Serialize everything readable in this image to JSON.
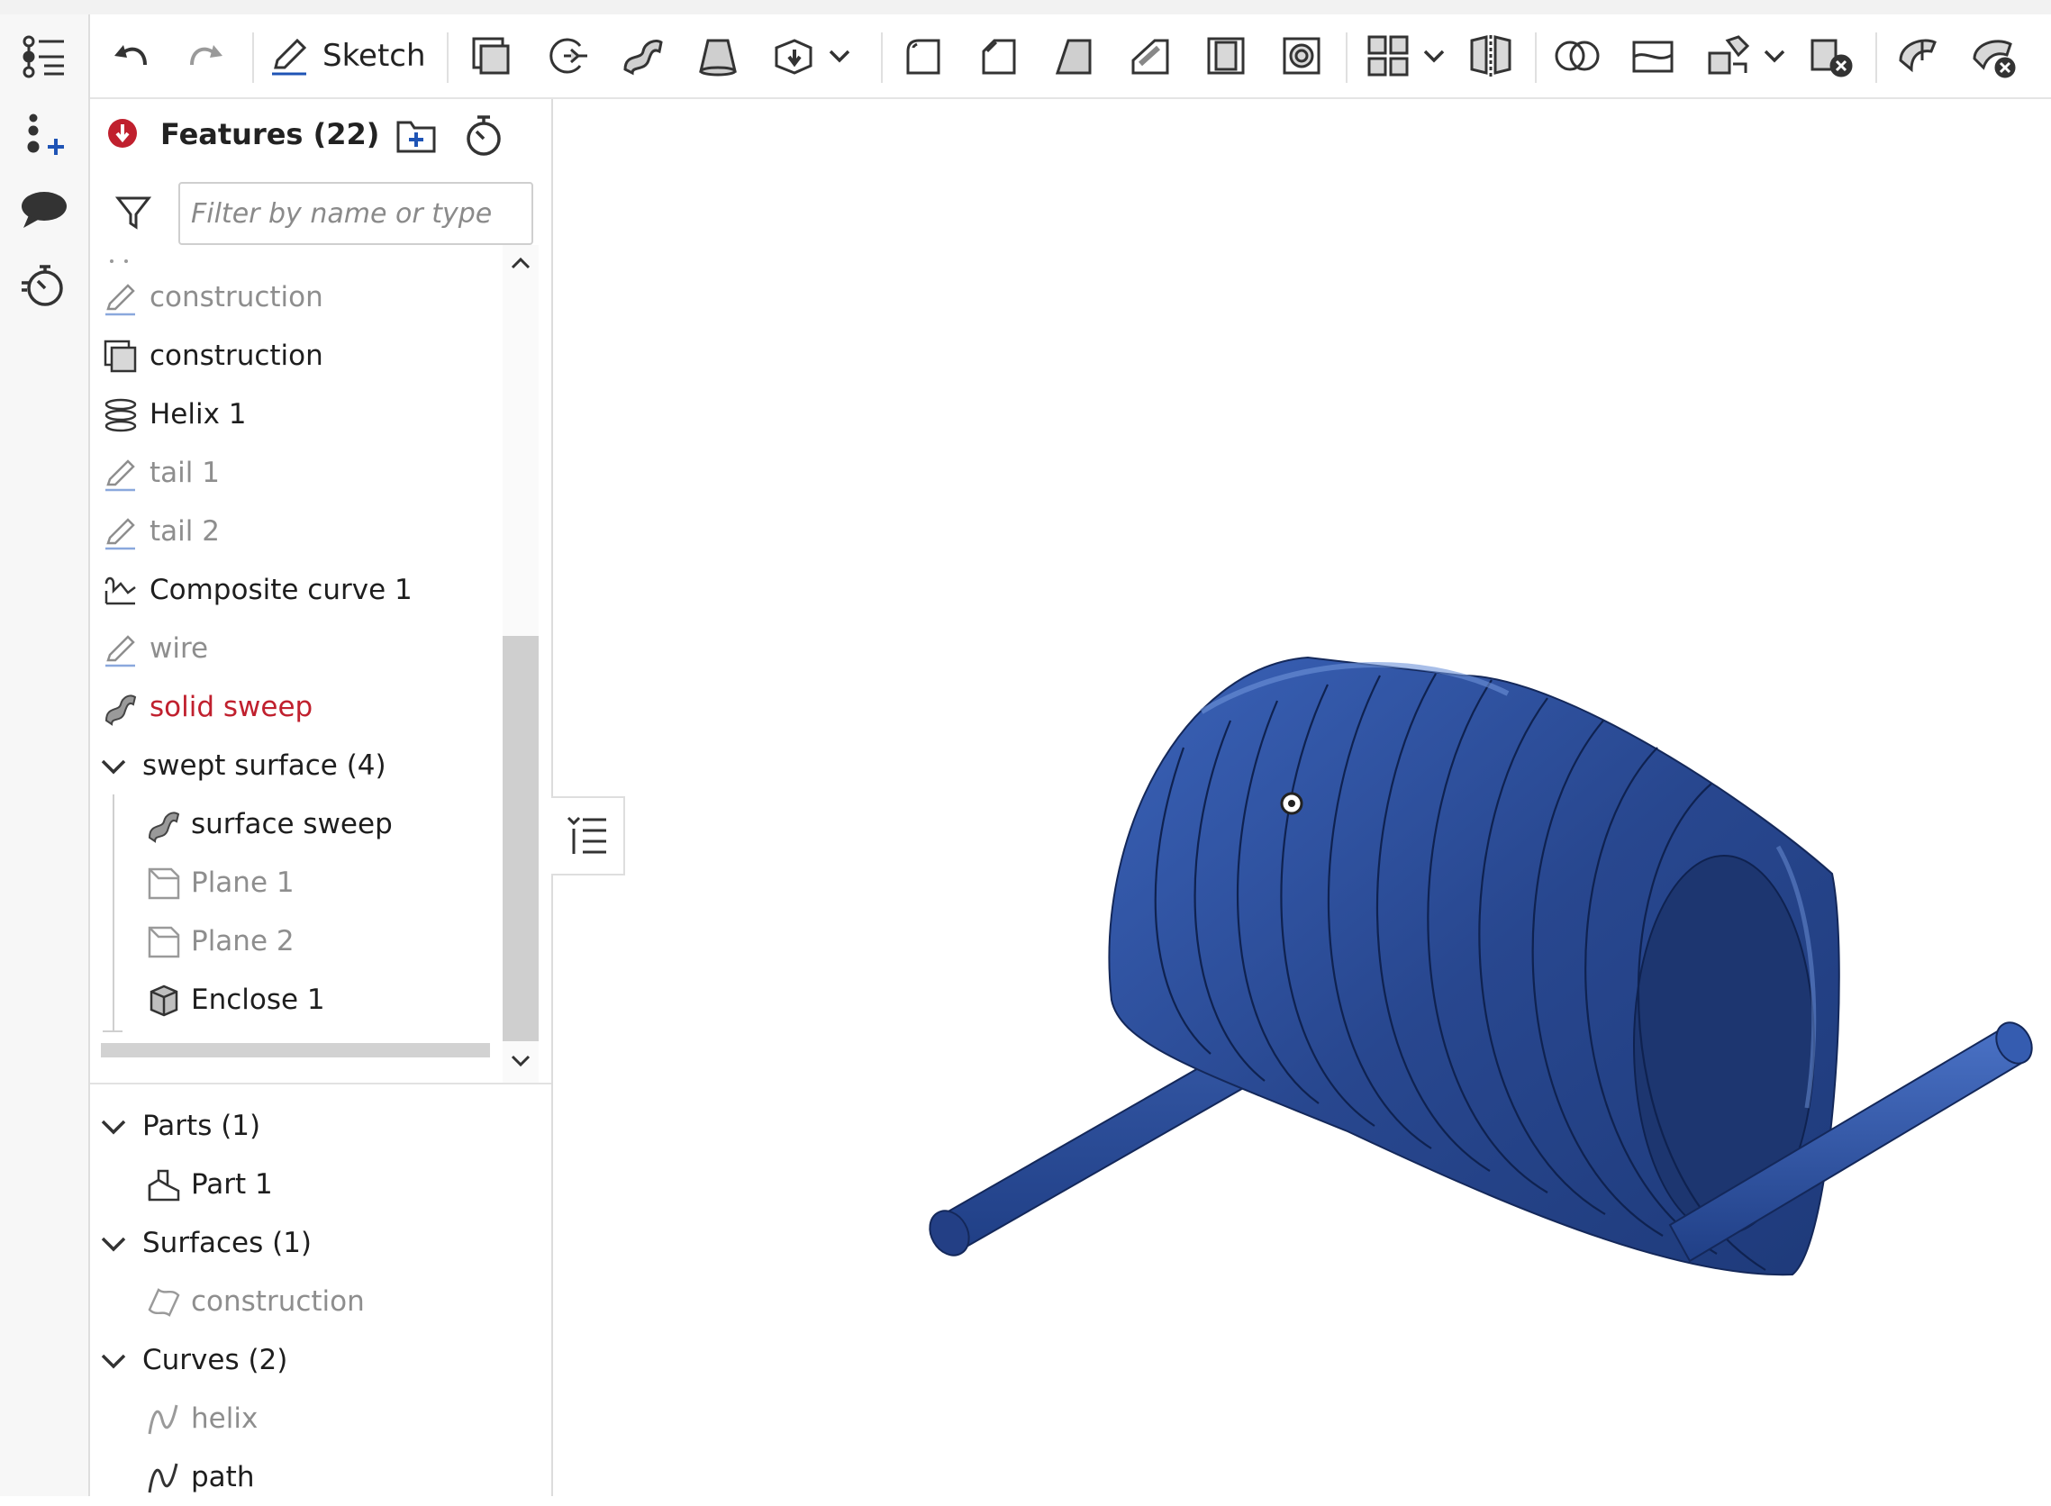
{
  "toolbar": {
    "sketch_label": "Sketch",
    "tools": [
      "undo-icon",
      "redo-icon",
      "extrude-icon",
      "revolve-icon",
      "sweep-icon",
      "loft-icon",
      "thicken-icon",
      "fillet-icon",
      "chamfer-icon",
      "draft-icon",
      "rib-icon",
      "shell-icon",
      "hole-icon",
      "pattern-icon",
      "mirror-icon",
      "boolean-icon",
      "split-icon",
      "transform-icon",
      "delete-part-icon",
      "helix-icon",
      "delete-face-icon"
    ]
  },
  "left_rail": [
    "feature-tree-icon",
    "add-variable-icon",
    "comment-icon",
    "performance-icon"
  ],
  "panel": {
    "title": "Features (22)",
    "filter_placeholder": "Filter by name or type",
    "features": [
      {
        "label": "construction",
        "state": "muted",
        "icon": "sketch-icon"
      },
      {
        "label": "construction",
        "state": "dark",
        "icon": "extrude-icon"
      },
      {
        "label": "Helix 1",
        "state": "dark",
        "icon": "helix-icon"
      },
      {
        "label": "tail 1",
        "state": "muted",
        "icon": "sketch-icon"
      },
      {
        "label": "tail 2",
        "state": "muted",
        "icon": "sketch-icon"
      },
      {
        "label": "Composite curve 1",
        "state": "dark",
        "icon": "composite-curve-icon"
      },
      {
        "label": "wire",
        "state": "muted",
        "icon": "sketch-icon"
      },
      {
        "label": "solid sweep",
        "state": "err",
        "icon": "sweep-icon"
      },
      {
        "label": "swept surface (4)",
        "state": "dark",
        "icon": "chevron-down-icon"
      },
      {
        "label": "surface sweep",
        "state": "dark",
        "icon": "sweep-icon"
      },
      {
        "label": "Plane 1",
        "state": "muted",
        "icon": "plane-icon"
      },
      {
        "label": "Plane 2",
        "state": "muted",
        "icon": "plane-icon"
      },
      {
        "label": "Enclose 1",
        "state": "dark",
        "icon": "enclose-icon"
      }
    ],
    "parts_header": "Parts (1)",
    "part_1": "Part 1",
    "surfaces_header": "Surfaces (1)",
    "surface_1": "construction",
    "curves_header": "Curves (2)",
    "curve_1": "helix",
    "curve_2": "path"
  },
  "colors": {
    "accent_blue": "#1f54b5",
    "error_red": "#c0202e",
    "spring_blue": "#2b4a96"
  }
}
